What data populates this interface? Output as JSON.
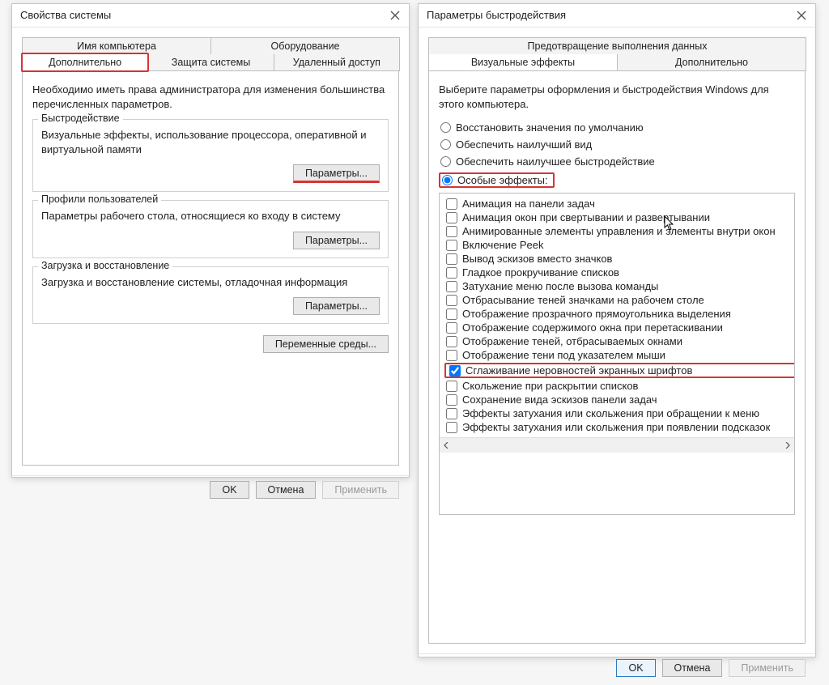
{
  "sysprops": {
    "title": "Свойства системы",
    "tabs_top": [
      "Имя компьютера",
      "Оборудование"
    ],
    "tabs_bottom": [
      "Дополнительно",
      "Защита системы",
      "Удаленный доступ"
    ],
    "admin_note": "Необходимо иметь права администратора для изменения большинства перечисленных параметров.",
    "performance": {
      "title": "Быстродействие",
      "desc": "Визуальные эффекты, использование процессора, оперативной и виртуальной памяти",
      "button": "Параметры..."
    },
    "profiles": {
      "title": "Профили пользователей",
      "desc": "Параметры рабочего стола, относящиеся ко входу в систему",
      "button": "Параметры..."
    },
    "startrec": {
      "title": "Загрузка и восстановление",
      "desc": "Загрузка и восстановление системы, отладочная информация",
      "button": "Параметры..."
    },
    "envvars_button": "Переменные среды...",
    "buttons": {
      "ok": "OK",
      "cancel": "Отмена",
      "apply": "Применить"
    }
  },
  "perfopts": {
    "title": "Параметры быстродействия",
    "tabs_top": [
      "Предотвращение выполнения данных"
    ],
    "tabs_bottom": [
      "Визуальные эффекты",
      "Дополнительно"
    ],
    "intro": "Выберите параметры оформления и быстродействия Windows для этого компьютера.",
    "radios": {
      "default": "Восстановить значения по умолчанию",
      "best_look": "Обеспечить наилучший вид",
      "best_perf": "Обеспечить наилучшее быстродействие",
      "custom": "Особые эффекты:"
    },
    "checks": [
      {
        "label": "Анимация на панели задач",
        "checked": false
      },
      {
        "label": "Анимация окон при свертывании и развертывании",
        "checked": false
      },
      {
        "label": "Анимированные элементы управления и элементы внутри окон",
        "checked": false
      },
      {
        "label": "Включение Peek",
        "checked": false
      },
      {
        "label": "Вывод эскизов вместо значков",
        "checked": false
      },
      {
        "label": "Гладкое прокручивание списков",
        "checked": false
      },
      {
        "label": "Затухание меню после вызова команды",
        "checked": false
      },
      {
        "label": "Отбрасывание теней значками на рабочем столе",
        "checked": false
      },
      {
        "label": "Отображение прозрачного прямоугольника выделения",
        "checked": false
      },
      {
        "label": "Отображение содержимого окна при перетаскивании",
        "checked": false
      },
      {
        "label": "Отображение теней, отбрасываемых окнами",
        "checked": false
      },
      {
        "label": "Отображение тени под указателем мыши",
        "checked": false
      },
      {
        "label": "Сглаживание неровностей экранных шрифтов",
        "checked": true,
        "highlight": true
      },
      {
        "label": "Скольжение при раскрытии списков",
        "checked": false
      },
      {
        "label": "Сохранение вида эскизов панели задач",
        "checked": false
      },
      {
        "label": "Эффекты затухания или скольжения при обращении к меню",
        "checked": false
      },
      {
        "label": "Эффекты затухания или скольжения при появлении подсказок",
        "checked": false
      }
    ],
    "buttons": {
      "ok": "OK",
      "cancel": "Отмена",
      "apply": "Применить"
    }
  }
}
